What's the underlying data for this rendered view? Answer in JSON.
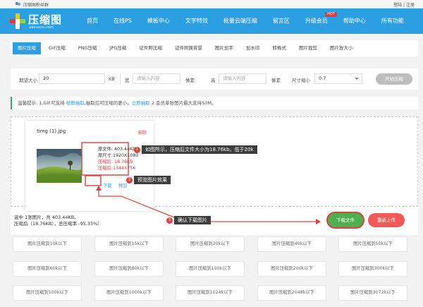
{
  "topbar": {
    "group_text": "压缩图粉丝群",
    "login": "登陆",
    "separator": " | ",
    "register": "注册"
  },
  "logo": {
    "title": "压缩图",
    "url": "yasuotu.com"
  },
  "nav": [
    {
      "label": "首页"
    },
    {
      "label": "在线PS"
    },
    {
      "label": "模板中心"
    },
    {
      "label": "文字特效"
    },
    {
      "label": "批量云端压缩"
    },
    {
      "label": "留言区"
    },
    {
      "label": "升级会员",
      "badge": "HOT"
    },
    {
      "label": "帮助中心"
    },
    {
      "label": "所有功能"
    }
  ],
  "subtabs": [
    {
      "label": "图片压缩",
      "active": true
    },
    {
      "label": "GIF压缩"
    },
    {
      "label": "PNG压缩"
    },
    {
      "label": "JPG压缩"
    },
    {
      "label": "证件照压缩"
    },
    {
      "label": "证件照换背景"
    },
    {
      "label": "图片加字"
    },
    {
      "label": "加水印"
    },
    {
      "label": "转格式"
    },
    {
      "label": "图片裁剪"
    },
    {
      "label": "图片放大小"
    }
  ],
  "settings": {
    "target_size_label": "期望大小",
    "target_size_value": "20",
    "target_size_unit": "KB",
    "width_label": "宽",
    "width_placeholder": "请输入内容",
    "width_unit": "像素",
    "height_label": "高",
    "height_placeholder": "请输入内容",
    "height_unit": "像素",
    "scale_label": "尺寸缩小",
    "scale_value": "0.7",
    "start_button": "开始压缩"
  },
  "notice": {
    "prefix": "温馨提示: 1.GIF可支持 ",
    "link1": "帧数抽取",
    "middle": ",抽取后可压缩的更小。",
    "link2": "立即抽取",
    "suffix": " 2.会员单张图片最大支持50M。"
  },
  "file_card": {
    "filename": "timg (1).jpg",
    "delete": "删除",
    "stats": {
      "original_size": "原文件: 403.44KB",
      "original_dims": "原尺寸:1920X1080",
      "compressed_size": "压缩后: 18.76KB",
      "compressed_dims": "压缩后:1344X756"
    },
    "download": "下载",
    "preview": "预览"
  },
  "summary": {
    "line1": "选中 1张图片，共 403.44KB,",
    "line2": "压缩后（18.76KB），总压缩率 -95.35%）"
  },
  "buttons": {
    "download_file": "下载文件",
    "reupload": "重新上传"
  },
  "annotations": [
    {
      "num": "1",
      "text": "如图所示，压缩后文件大小为18.76kb，低于20k"
    },
    {
      "num": "2",
      "text": "预览图片效果"
    },
    {
      "num": "3",
      "text": "确认下载图片"
    }
  ],
  "presets": [
    "图片压缩到10k以下",
    "图片压缩到15k以下",
    "图片压缩到20k以下",
    "图片压缩到40k以下",
    "图片压缩到50k以下",
    "图片压缩到60k以下",
    "图片压缩到80k以下",
    "图片压缩到100k以下",
    "图片压缩到200k以下",
    "图片压缩到300k以下",
    "图片压缩到500k以下",
    "图片压缩到1000k以下",
    "图片压缩到1024k以下",
    "图片压缩到2048k以下",
    "图片压缩到3072k以下"
  ],
  "colors": {
    "brand_blue": "#2c9fe3",
    "danger_red": "#e4393c",
    "success_green": "#4caf50",
    "callout_dark": "#3d3d3d"
  }
}
